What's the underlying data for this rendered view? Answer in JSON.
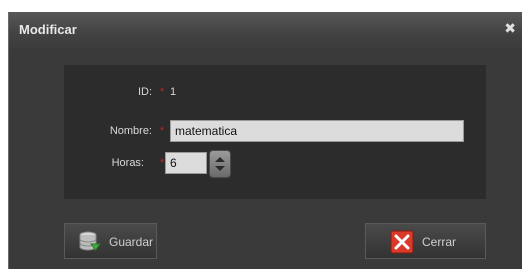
{
  "window": {
    "title": "Modificar",
    "close_glyph": "✖"
  },
  "form": {
    "id_label": "ID:",
    "id_required": "*",
    "id_value": "1",
    "nombre_label": "Nombre:",
    "nombre_required": "*",
    "nombre_value": "matematica",
    "horas_label": "Horas:",
    "horas_required": "*",
    "horas_value": "6"
  },
  "buttons": {
    "guardar_label": "Guardar",
    "guardar_icon": "database-save-icon",
    "cerrar_label": "Cerrar",
    "cerrar_icon": "close-x-red-icon"
  },
  "colors": {
    "required_marker": "#c62020",
    "window_bg": "#3a3a3a",
    "panel_bg": "#2c2c2c"
  }
}
